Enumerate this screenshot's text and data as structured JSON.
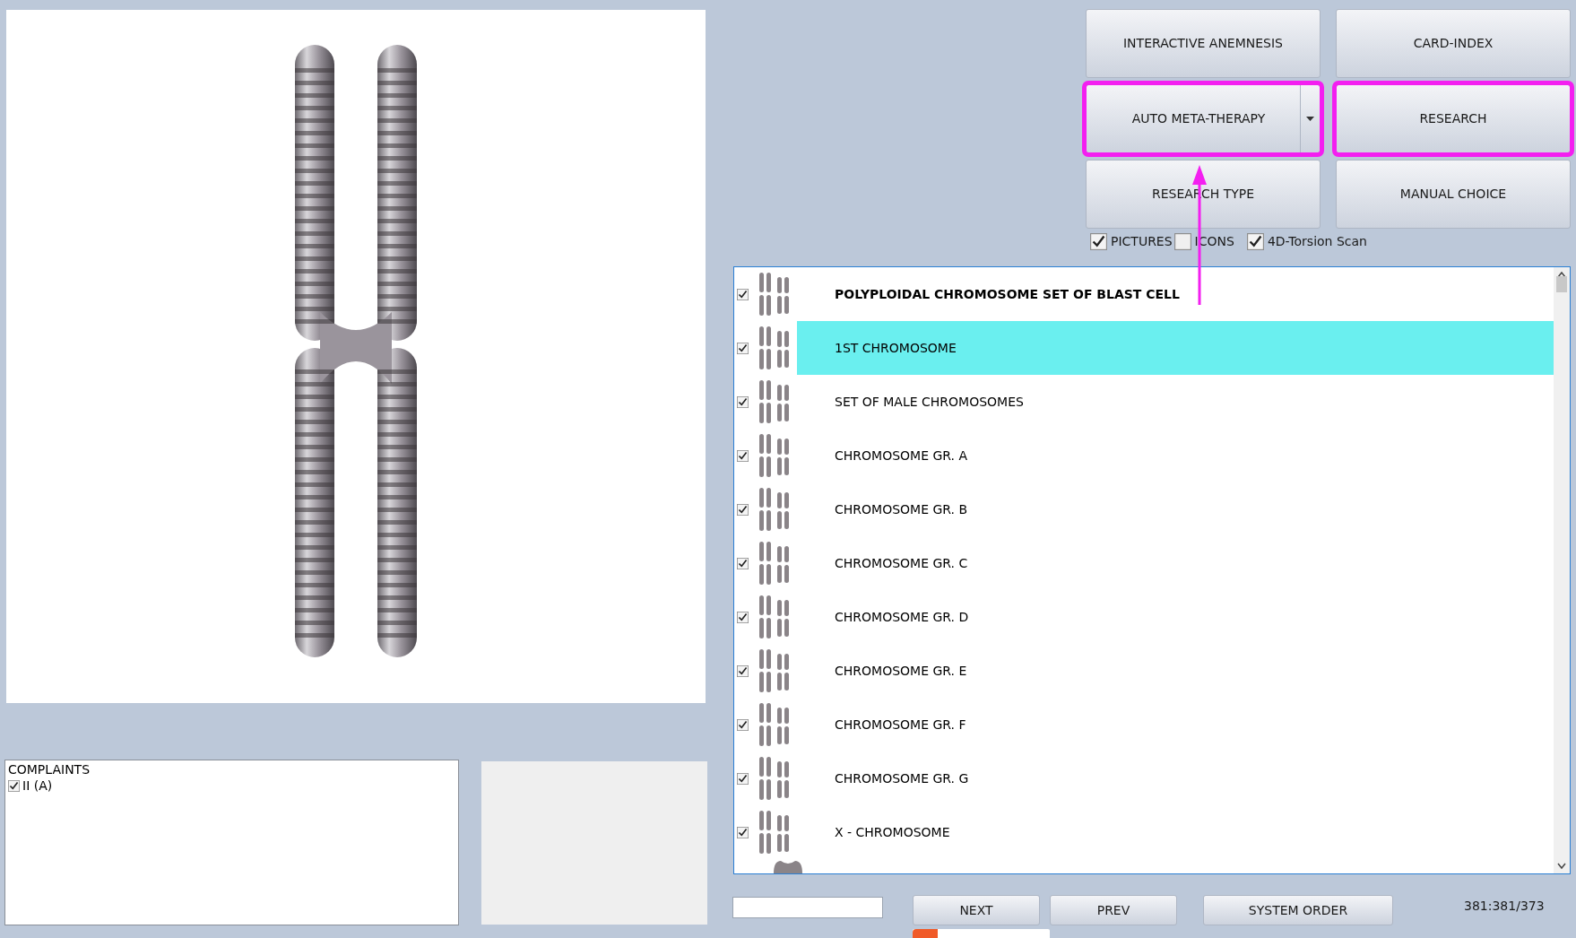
{
  "buttons": [
    {
      "label": "INTERACTIVE ANEMNESIS",
      "kind": "plain",
      "highlighted": false
    },
    {
      "label": "CARD-INDEX",
      "kind": "plain",
      "highlighted": false
    },
    {
      "label": "AUTO META-THERAPY",
      "kind": "split",
      "highlighted": true
    },
    {
      "label": "RESEARCH",
      "kind": "plain",
      "highlighted": true
    },
    {
      "label": "RESEARCH TYPE",
      "kind": "plain",
      "highlighted": false
    },
    {
      "label": "MANUAL CHOICE",
      "kind": "plain",
      "highlighted": false
    }
  ],
  "options": [
    {
      "label": "PICTURES",
      "checked": true
    },
    {
      "label": "ICONS",
      "checked": false
    },
    {
      "label": "4D-Torsion Scan",
      "checked": true
    }
  ],
  "list": [
    {
      "label": "POLYPLOIDAL CHROMOSOME SET OF BLAST CELL",
      "checked": true,
      "selected": false,
      "bold": true
    },
    {
      "label": "1ST CHROMOSOME",
      "checked": true,
      "selected": true,
      "bold": false
    },
    {
      "label": "SET OF MALE CHROMOSOMES",
      "checked": true,
      "selected": false,
      "bold": false
    },
    {
      "label": "CHROMOSOME GR. A",
      "checked": true,
      "selected": false,
      "bold": false
    },
    {
      "label": "CHROMOSOME GR. B",
      "checked": true,
      "selected": false,
      "bold": false
    },
    {
      "label": "CHROMOSOME GR. C",
      "checked": true,
      "selected": false,
      "bold": false
    },
    {
      "label": "CHROMOSOME GR. D",
      "checked": true,
      "selected": false,
      "bold": false
    },
    {
      "label": "CHROMOSOME GR. E",
      "checked": true,
      "selected": false,
      "bold": false
    },
    {
      "label": "CHROMOSOME GR. F",
      "checked": true,
      "selected": false,
      "bold": false
    },
    {
      "label": "CHROMOSOME GR. G",
      "checked": true,
      "selected": false,
      "bold": false
    },
    {
      "label": "X - CHROMOSOME",
      "checked": true,
      "selected": false,
      "bold": false
    }
  ],
  "complaints": {
    "title": "COMPLAINTS",
    "items": [
      {
        "label": "II (A)",
        "checked": true
      }
    ]
  },
  "nav_buttons": [
    "NEXT",
    "PREV",
    "SYSTEM ORDER"
  ],
  "counter": "381:381/373"
}
